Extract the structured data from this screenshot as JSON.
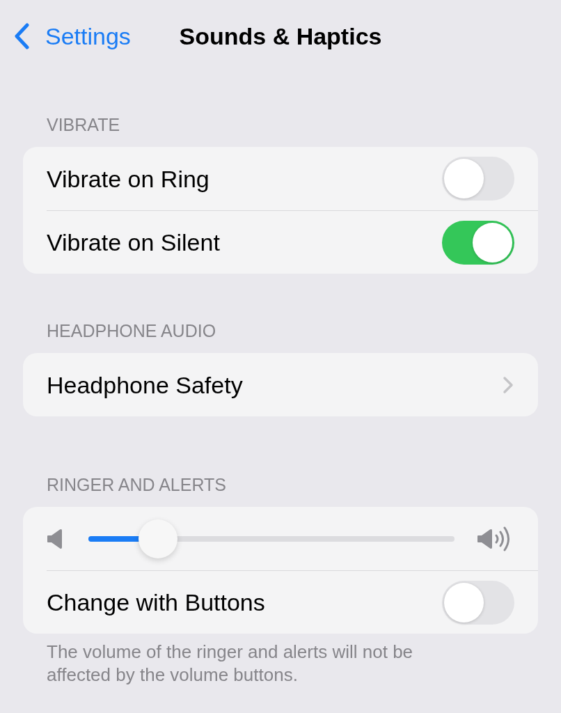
{
  "nav": {
    "back_label": "Settings",
    "title": "Sounds & Haptics"
  },
  "sections": [
    {
      "header": "VIBRATE",
      "rows": [
        {
          "kind": "toggle",
          "label": "Vibrate on Ring",
          "on": false
        },
        {
          "kind": "toggle",
          "label": "Vibrate on Silent",
          "on": true
        }
      ]
    },
    {
      "header": "HEADPHONE AUDIO",
      "rows": [
        {
          "kind": "link",
          "label": "Headphone Safety"
        }
      ]
    },
    {
      "header": "RINGER AND ALERTS",
      "rows": [
        {
          "kind": "slider",
          "level": 0.19
        },
        {
          "kind": "toggle",
          "label": "Change with Buttons",
          "on": false
        }
      ],
      "footer": "The volume of the ringer and alerts will not be affected by the volume buttons."
    }
  ]
}
